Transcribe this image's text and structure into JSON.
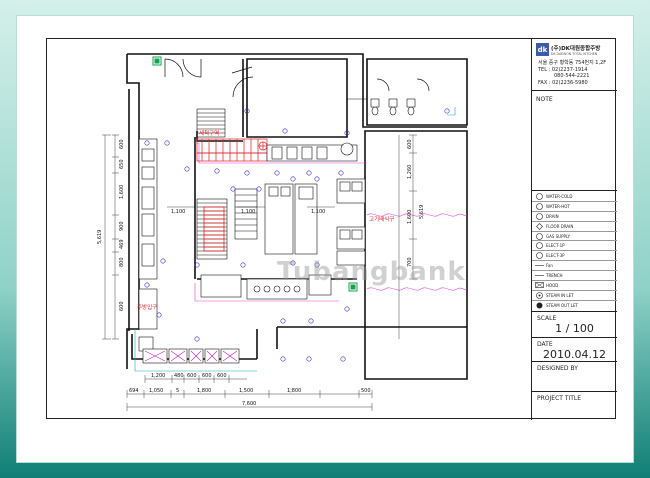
{
  "company": {
    "logo_mark": "dk",
    "name": "(주)DK대원종합주방",
    "name_en": "DK DAEWON TOTAL KITCHEN",
    "address": "서울 중구 황학동 754번지 1,2F",
    "tel": "TEL : 02)2237-1914",
    "mobile": "080-544-2221",
    "fax": "FAX : 02)2236-5980"
  },
  "note_label": "NOTE",
  "legend": [
    {
      "symbol": "circle",
      "label": "WATER-COLD"
    },
    {
      "symbol": "circle",
      "label": "WATER-HOT"
    },
    {
      "symbol": "circle",
      "label": "DRAIN"
    },
    {
      "symbol": "diamond",
      "label": "FLOOR DRAIN"
    },
    {
      "symbol": "circle",
      "label": "GAS SUPPLY"
    },
    {
      "symbol": "circle",
      "label": "ELECT-1P"
    },
    {
      "symbol": "circle",
      "label": "ELECT-3P"
    },
    {
      "symbol": "line",
      "label": "Fan"
    },
    {
      "symbol": "line",
      "label": "TRENCH"
    },
    {
      "symbol": "box-x",
      "label": "HOOD"
    },
    {
      "symbol": "circle-open",
      "label": "STEAM IN LET"
    },
    {
      "symbol": "circle-filled",
      "label": "STEAM OUT LET"
    }
  ],
  "scale_label": "SCALE",
  "scale_value": "1 / 100",
  "date_label": "DATE",
  "date_value": "2010.04.12",
  "designed_by_label": "DESIGNED BY",
  "designed_by_value": "",
  "project_title_label": "PROJECT TITLE",
  "project_title_value": "",
  "watermark": "Tubangbank",
  "plan_labels": {
    "room_1": "세척구역",
    "room_2": "고기배식구",
    "room_3": "주방입구"
  },
  "dimensions": {
    "left_total": "5,619",
    "left_parts": [
      "600",
      "650",
      "1,600",
      "900",
      "469",
      "800",
      "600"
    ],
    "right_total": "5,619",
    "right_parts": [
      "600",
      "1,260",
      "1,600",
      "700"
    ],
    "inner_h": [
      "1,100",
      "1,100",
      "1,100"
    ],
    "bottom_row1": [
      "1,200",
      "480",
      "600",
      "600",
      "600"
    ],
    "bottom_row2": [
      "694",
      "1,050",
      "5",
      "1,800",
      "1,500",
      "1,800",
      "500"
    ],
    "bottom_total": "7,600"
  },
  "colors": {
    "red": "#e02020",
    "blue": "#3030c0",
    "green": "#1aa050",
    "magenta": "#e040e0",
    "cyan": "#00b0c8"
  }
}
